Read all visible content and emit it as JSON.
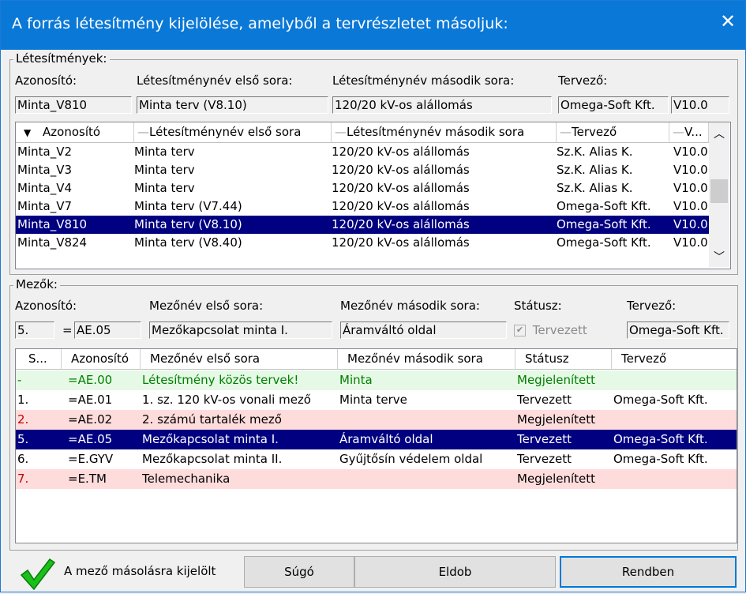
{
  "dialog": {
    "title": "A forrás létesítmény kijelölése, amelyből a tervrészletet másoljuk:",
    "close": "✕"
  },
  "facilities": {
    "group_label": "Létesítmények:",
    "labels": {
      "id": "Azonosító:",
      "name1": "Létesítménynév első sora:",
      "name2": "Létesítménynév második sora:",
      "designer": "Tervező:"
    },
    "current": {
      "id": "Minta_V810",
      "name1": "Minta terv (V8.10)",
      "name2": "120/20 kV-os alállomás",
      "designer": "Omega-Soft Kft.",
      "version": "V10.0"
    },
    "columns": [
      "Azonosító",
      "Létesítménynév első sora",
      "Létesítménynév második sora",
      "Tervező",
      "V..."
    ],
    "rows": [
      [
        "Minta_V2",
        "Minta terv",
        "120/20 kV-os alállomás",
        "Sz.K. Alias K.",
        "V10.0"
      ],
      [
        "Minta_V3",
        "Minta terv",
        "120/20 kV-os alállomás",
        "Sz.K. Alias K.",
        "V10.0"
      ],
      [
        "Minta_V4",
        "Minta terv",
        "120/20 kV-os alállomás",
        "Sz.K. Alias K.",
        "V10.0"
      ],
      [
        "Minta_V7",
        "Minta terv (V7.44)",
        "120/20 kV-os alállomás",
        "Omega-Soft Kft.",
        "V10.0"
      ],
      [
        "Minta_V810",
        "Minta terv (V8.10)",
        "120/20 kV-os alállomás",
        "Omega-Soft Kft.",
        "V10.0"
      ],
      [
        "Minta_V824",
        "Minta terv (V8.40)",
        "120/20 kV-os alállomás",
        "Omega-Soft Kft.",
        "V10.0"
      ]
    ],
    "selected_index": 4
  },
  "fields": {
    "group_label": "Mezők:",
    "labels": {
      "id": "Azonosító:",
      "name1": "Mezőnév első sora:",
      "name2": "Mezőnév második sora:",
      "status": "Státusz:",
      "designer": "Tervező:"
    },
    "current": {
      "num": "5.",
      "eq": "=",
      "code": "AE.05",
      "name1": "Mezőkapcsolat minta I.",
      "name2": "Áramváltó oldal",
      "status": "Tervezett",
      "designer": "Omega-Soft Kft."
    },
    "columns": [
      "S...",
      "Azonosító",
      "Mezőnév első sora",
      "Mezőnév második sora",
      "Státusz",
      "Tervező"
    ],
    "rows": [
      [
        "-",
        "=AE.00",
        "Létesítmény közös tervek!",
        "Minta",
        "Megjelenített",
        ""
      ],
      [
        "1.",
        "=AE.01",
        "1. sz. 120 kV-os vonali mező",
        "Minta terve",
        "Tervezett",
        "Omega-Soft Kft."
      ],
      [
        "2.",
        "=AE.02",
        "2. számú tartalék mező",
        "",
        "Megjelenített",
        ""
      ],
      [
        "5.",
        "=AE.05",
        "Mezőkapcsolat minta I.",
        "Áramváltó oldal",
        "Tervezett",
        "Omega-Soft Kft."
      ],
      [
        "6.",
        "=E.GYV",
        "Mezőkapcsolat minta II.",
        "Gyűjtősín védelem oldal",
        "Tervezett",
        "Omega-Soft Kft."
      ],
      [
        "7.",
        "=E.TM",
        "Telemechanika",
        "",
        "Megjelenített",
        ""
      ]
    ],
    "row_styles": [
      "green",
      "normal",
      "red",
      "selected",
      "normal",
      "red"
    ],
    "colors": {
      "green_bg": "#e6f9e6",
      "green_text": "#008000",
      "red_bg": "#ffdcdc",
      "red_text": "#c00000",
      "selected_bg": "#000080"
    }
  },
  "footer": {
    "check_icon": "check-icon",
    "info": "A mező másolásra kijelölt",
    "help": "Súgó",
    "discard": "Eldob",
    "ok": "Rendben"
  }
}
